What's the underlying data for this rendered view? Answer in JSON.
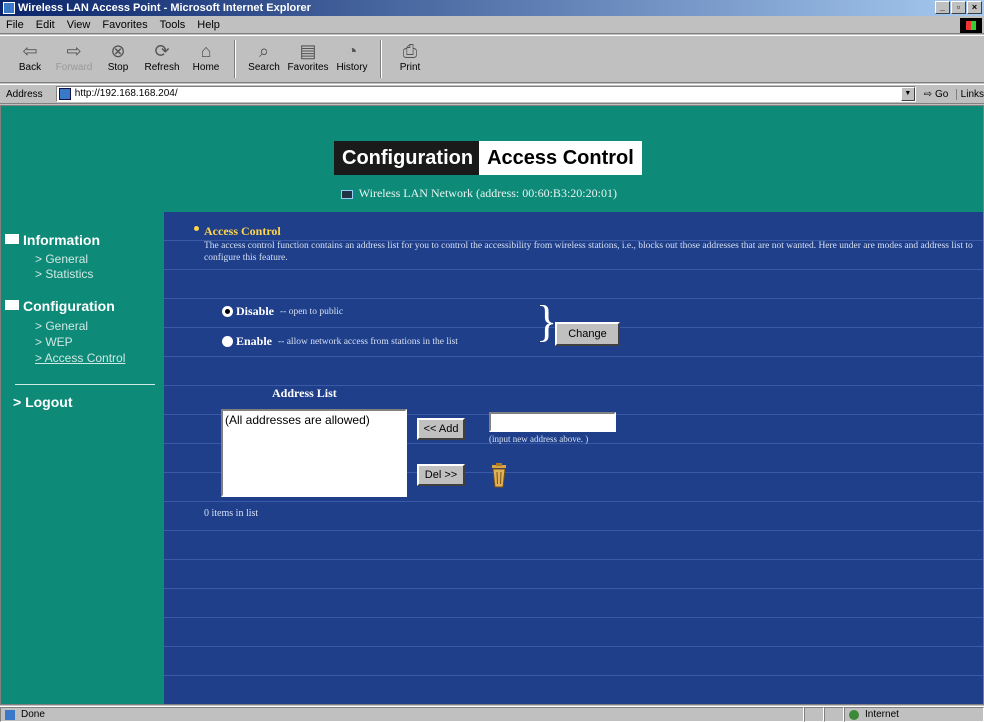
{
  "window": {
    "title": "Wireless LAN Access Point - Microsoft Internet Explorer",
    "buttons": [
      "_",
      "▫",
      "×"
    ]
  },
  "menubar": [
    "File",
    "Edit",
    "View",
    "Favorites",
    "Tools",
    "Help"
  ],
  "toolbar": {
    "back": "Back",
    "forward": "Forward",
    "stop": "Stop",
    "refresh": "Refresh",
    "home": "Home",
    "search": "Search",
    "favorites": "Favorites",
    "history": "History",
    "print": "Print"
  },
  "addressbar": {
    "label": "Address",
    "url": "http://192.168.168.204/",
    "go": "Go",
    "links": "Links"
  },
  "banner": {
    "title_dark": "Configuration",
    "title_light": "Access Control",
    "subtitle": "Wireless LAN Network (address: 00:60:B3:20:20:01)"
  },
  "sidenav": {
    "information": "Information",
    "info_general": "> General",
    "info_statistics": "> Statistics",
    "configuration": "Configuration",
    "conf_general": "> General",
    "conf_wep": "> WEP",
    "conf_access": "> Access Control",
    "logout": "> Logout"
  },
  "content": {
    "section_title": "Access Control",
    "section_desc": "The access control function contains an address list for you to control the accessibility from wireless stations, i.e., blocks out those addresses that are not wanted. Here under are modes and address list to configure this feature.",
    "disable_label": "Disable",
    "disable_desc": "-- open to public",
    "enable_label": "Enable",
    "enable_desc": "-- allow network access from stations in the list",
    "change_button": "Change",
    "address_list_title": "Address List",
    "list_items": [
      "(All addresses are allowed)"
    ],
    "add_button": "<< Add",
    "del_button": "Del >>",
    "new_address_value": "",
    "new_address_hint": "(input new address above. )",
    "items_count": "0 items in list"
  },
  "statusbar": {
    "status": "Done",
    "zone": "Internet"
  }
}
